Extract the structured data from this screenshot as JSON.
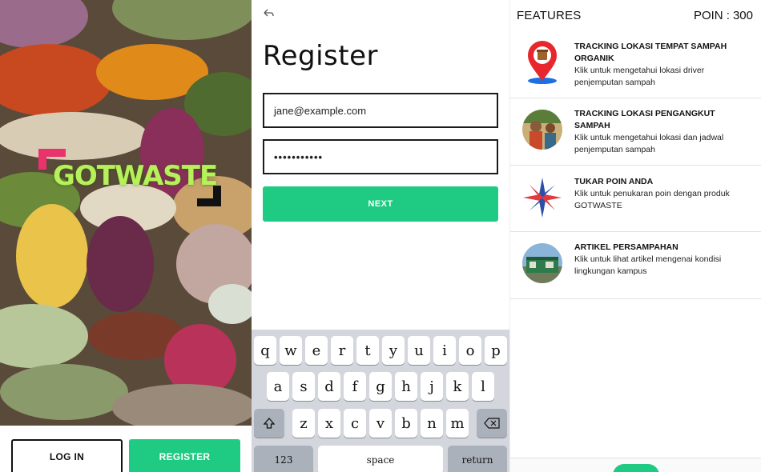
{
  "splash": {
    "logo_text": "GOTWASTE",
    "login_label": "LOG IN",
    "register_label": "REGISTER"
  },
  "register": {
    "title": "Register",
    "email_value": "jane@example.com",
    "password_value": "•••••••••••",
    "next_label": "NEXT"
  },
  "keyboard": {
    "row1": [
      "q",
      "w",
      "e",
      "r",
      "t",
      "y",
      "u",
      "i",
      "o",
      "p"
    ],
    "row2": [
      "a",
      "s",
      "d",
      "f",
      "g",
      "h",
      "j",
      "k",
      "l"
    ],
    "row3": [
      "z",
      "x",
      "c",
      "v",
      "b",
      "n",
      "m"
    ],
    "numbers_label": "123",
    "space_label": "space",
    "return_label": "return"
  },
  "features": {
    "title": "FEATURES",
    "poin_label": "POIN :",
    "poin_value": "300",
    "items": [
      {
        "heading": "TRACKING LOKASI TEMPAT SAMPAH ORGANIK",
        "desc": "Klik untuk mengetahui lokasi driver penjemputan sampah",
        "icon": "map-pin-icon"
      },
      {
        "heading": "TRACKING LOKASI PENGANGKUT SAMPAH",
        "desc": "Klik untuk mengetahui lokasi dan  jadwal penjemputan sampah",
        "icon": "collector-photo"
      },
      {
        "heading": "TUKAR POIN ANDA",
        "desc": "Klik untuk penukaran poin dengan produk GOTWASTE",
        "icon": "compass-star-icon"
      },
      {
        "heading": "ARTIKEL PERSAMPAHAN",
        "desc": "Klik untuk lihat artikel mengenai kondisi lingkungan kampus",
        "icon": "dumpster-photo"
      }
    ]
  },
  "colors": {
    "accent_green": "#1fca82",
    "logo_green": "#b6f05a",
    "logo_bracket_pink": "#e8336d",
    "keyboard_bg": "#d3d6dc"
  }
}
